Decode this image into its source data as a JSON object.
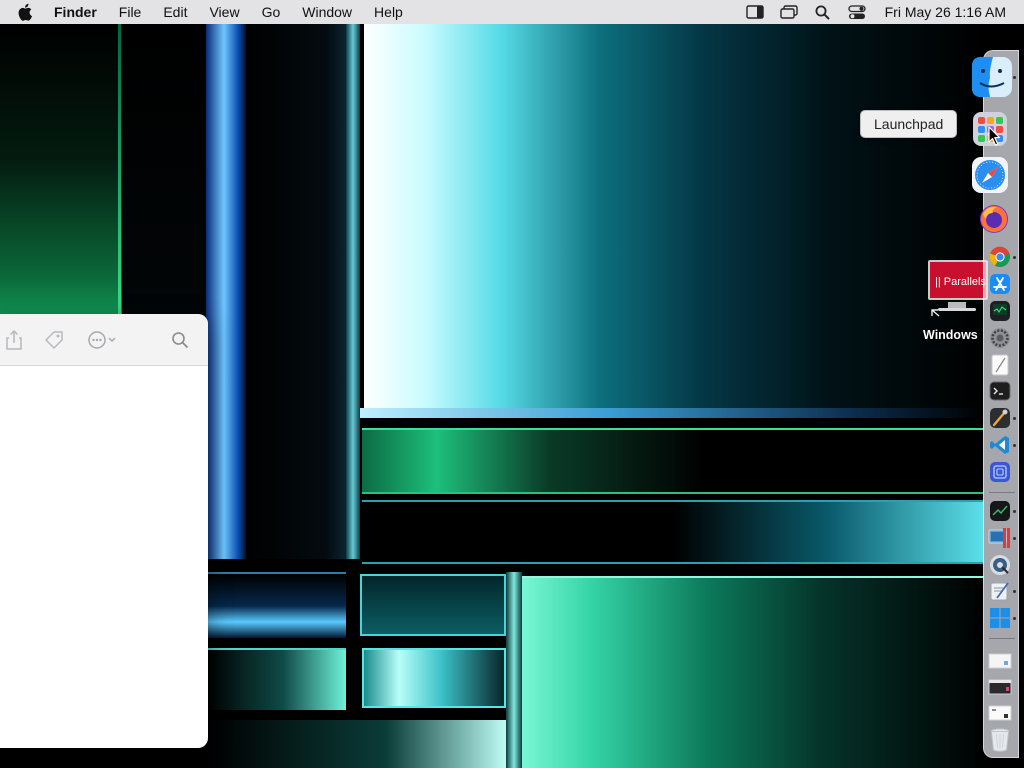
{
  "menubar": {
    "app_name": "Finder",
    "menus": [
      "File",
      "Edit",
      "View",
      "Go",
      "Window",
      "Help"
    ],
    "clock": "Fri May 26  1:16 AM",
    "status_icons": [
      "sidebar-icon",
      "window-stack-icon",
      "spotlight-search-icon",
      "control-center-icon"
    ]
  },
  "desktop": {
    "icons": [
      {
        "label": "Windows",
        "badge": "|| Parallels"
      }
    ]
  },
  "dock": {
    "tooltip": "Launchpad",
    "apps": [
      "Finder",
      "Launchpad",
      "Safari",
      "Firefox",
      "Chrome",
      "App Store",
      "Activity Monitor",
      "System Preferences",
      "TextEdit",
      "Terminal",
      "Xcode Instruments",
      "Visual Studio Code",
      "Screens",
      "Stocks",
      "Parallels Desktop",
      "Disk Utility",
      "Script Editor",
      "Windows 11",
      "Document 1",
      "Document 2",
      "Document 3",
      "Trash"
    ]
  },
  "finder_window": {
    "toolbar": [
      "share-icon",
      "tag-icon",
      "more-actions-icon",
      "search-icon"
    ]
  },
  "colors": {
    "menubar_bg": "#e3e3e5",
    "accent_cyan": "#56dbe6",
    "accent_green": "#1dbf7c"
  }
}
